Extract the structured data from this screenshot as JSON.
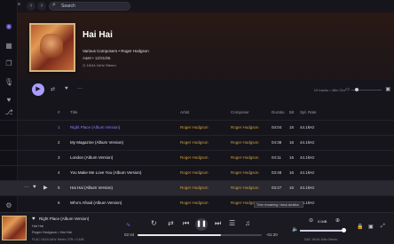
{
  "topbar": {
    "search_placeholder": "Search"
  },
  "album": {
    "title": "Hai Hai",
    "composers_line": "Various Composers • Roger Hodgson",
    "label_date": "A&M • 12/31/86",
    "quality": "16/44.1kHz Stereo"
  },
  "controls": {
    "tracks_summary": "10 tracks • 48m 31s"
  },
  "table": {
    "headers": {
      "num": "#",
      "title": "Title",
      "artist": "Artist",
      "composer": "Composer",
      "duration": "Duratio",
      "bit": "Bit",
      "rate": "Spl. Rate"
    },
    "rows": [
      {
        "num": "1",
        "title": "Right Place (Album Version)",
        "artist": "Roger Hodgson",
        "composer": "Roger Hodgson",
        "duration": "04:04",
        "bit": "16",
        "rate": "44.1kHz"
      },
      {
        "num": "2",
        "title": "My Magazine (Album Version)",
        "artist": "Roger Hodgson",
        "composer": "Roger Hodgson",
        "duration": "04:38",
        "bit": "16",
        "rate": "44.1kHz"
      },
      {
        "num": "3",
        "title": "London (Album Version)",
        "artist": "Roger Hodgson",
        "composer": "Roger Hodgson",
        "duration": "04:11",
        "bit": "16",
        "rate": "44.1kHz"
      },
      {
        "num": "4",
        "title": "You Make Me Love You (Album Version)",
        "artist": "Roger Hodgson",
        "composer": "Roger Hodgson",
        "duration": "03:48",
        "bit": "16",
        "rate": "44.1kHz"
      },
      {
        "num": "5",
        "title": "Hai Hai (Album Version)",
        "artist": "Roger Hodgson",
        "composer": "Roger Hodgson",
        "duration": "03:27",
        "bit": "16",
        "rate": "44.1kHz"
      },
      {
        "num": "6",
        "title": "Who's Afraid (Album Version)",
        "artist": "Roger Hodgson",
        "composer": "Roger Hodgson",
        "duration": "05:27",
        "bit": "16",
        "rate": "44.1kHz"
      }
    ],
    "tooltip": "Time remaining / track duration"
  },
  "player": {
    "track_title": "Right Place (Album Version)",
    "album": "Hai Hai",
    "artist_line": "Roger Hodgson • Hai Hai",
    "quality": "FLAC 16/44.1kHz Stereo 2TB • 0.44B",
    "elapsed": "02:44",
    "remaining": "-01:20",
    "progress_fraction": 0.67,
    "volume_label": "0.0dB",
    "volume_fraction": 0.95,
    "output": "DAC 16/44.1kHz Stereo"
  },
  "colors": {
    "accent": "#8f7eff",
    "artist_gold": "#cfa03a"
  }
}
